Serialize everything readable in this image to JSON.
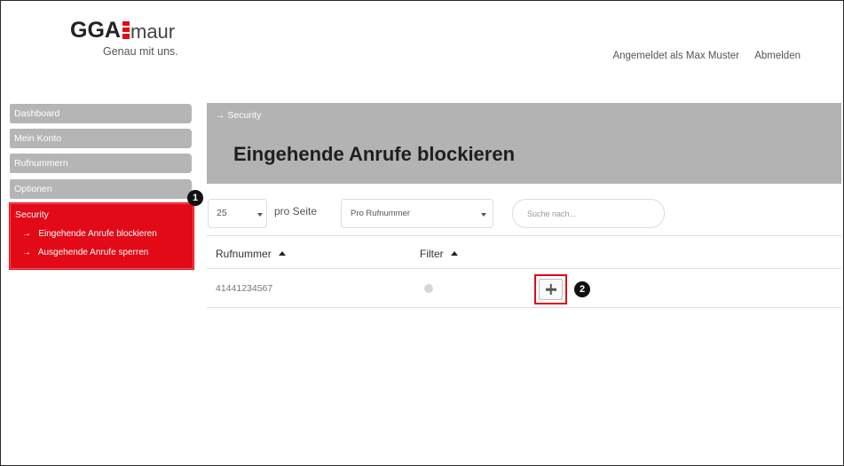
{
  "header": {
    "logo_text": "GGA",
    "logo_sub": "maur",
    "tagline": "Genau mit uns.",
    "logged_in": "Angemeldet als Max Muster",
    "logout": "Abmelden"
  },
  "sidebar": {
    "items": [
      {
        "label": "Dashboard"
      },
      {
        "label": "Mein Konto"
      },
      {
        "label": "Rufnummern"
      },
      {
        "label": "Optionen"
      }
    ],
    "security": {
      "label": "Security",
      "subitems": [
        {
          "arrow": "→",
          "label": "Eingehende Anrufe blockieren"
        },
        {
          "arrow": "→",
          "label": "Ausgehende Anrufe sperren"
        }
      ]
    }
  },
  "badges": {
    "one": "1",
    "two": "2"
  },
  "main": {
    "breadcrumb": "→  Security",
    "title": "Eingehende Anrufe blockieren",
    "per_page_value": "25",
    "per_page_label": "pro Seite",
    "filter_select": "Pro Rufnummer",
    "search_placeholder": "Suche nach...",
    "columns": [
      "Rufnummer",
      "Filter"
    ],
    "rows": [
      {
        "number": "41441234567"
      }
    ]
  },
  "colors": {
    "accent": "#e10a16",
    "nav_gray": "#b5b5b5",
    "hero_gray": "#b3b3b3"
  },
  "icons": [
    "plus-icon",
    "chevron-down-icon",
    "sort-up-icon",
    "arrow-right-icon",
    "filter-status-dot"
  ]
}
